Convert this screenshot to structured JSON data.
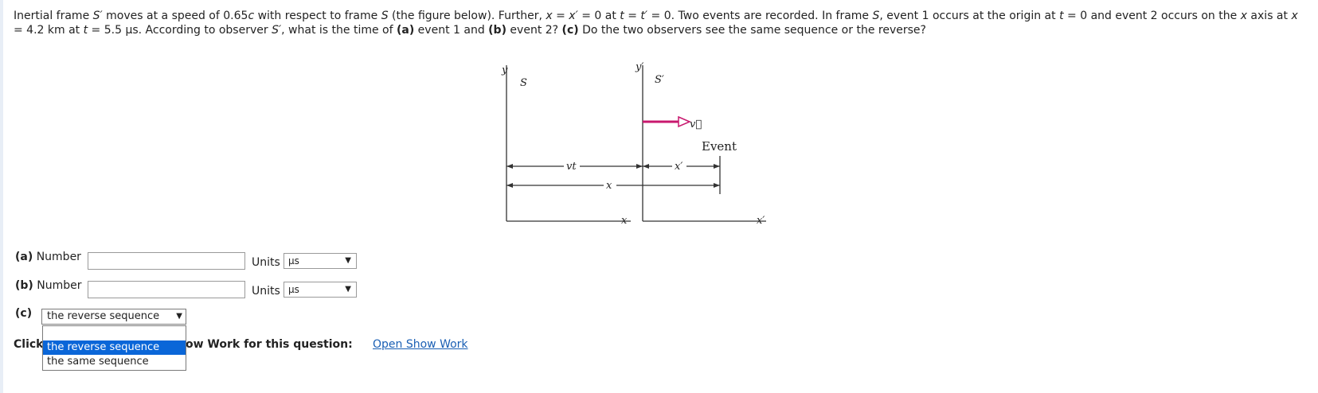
{
  "question": {
    "s1": "Inertial frame ",
    "s2": "S′",
    "s3": " moves at a speed of 0.65",
    "s4": "c",
    "s5": " with respect to frame ",
    "s6": "S",
    "s7": " (the figure below). Further, ",
    "s8": "x",
    "s9": " = ",
    "s10": "x′",
    "s11": " = 0 at ",
    "s12": "t",
    "s13": " = ",
    "s14": "t′",
    "s15": " = 0. Two events are recorded. In frame ",
    "s16": "S",
    "s17": ", event 1 occurs at the origin at ",
    "s18": "t",
    "s19": " = 0 and event 2 occurs on the ",
    "s20": "x",
    "s21": " axis at ",
    "s22": "x",
    "s23": " = 4.2 km at ",
    "s24": "t",
    "s25": " = 5.5 μs. According to observer ",
    "s26": "S′",
    "s27": ", what is the time of ",
    "s28": "(a)",
    "s29": " event 1 and ",
    "s30": "(b)",
    "s31": " event 2? ",
    "s32": "(c)",
    "s33": " Do the two observers see the same sequence or the reverse?"
  },
  "figure": {
    "y_label": "y",
    "s_label": "S",
    "yprime_label": "y′",
    "sprime_label": "S′",
    "v_label": "v⃗",
    "event_label": "Event",
    "vt_label": "vt",
    "xprime_dim_label": "x′",
    "x_dim_label": "x",
    "x_axis_label": "x",
    "xprime_axis_label": "x′",
    "arrow_color": "#c8186e"
  },
  "part_a": {
    "label": "(a)",
    "text": " Number",
    "value": "",
    "units_label": "Units",
    "unit": "μs"
  },
  "part_b": {
    "label": "(b)",
    "text": " Number",
    "value": "",
    "units_label": "Units",
    "unit": "μs"
  },
  "part_c": {
    "label": "(c)",
    "selected": "the reverse sequence",
    "options": [
      "the reverse sequence",
      "the same sequence"
    ]
  },
  "footer": {
    "click_text": "Click",
    "show_work_text": "ow Work for this question:",
    "link_text": "Open Show Work"
  }
}
